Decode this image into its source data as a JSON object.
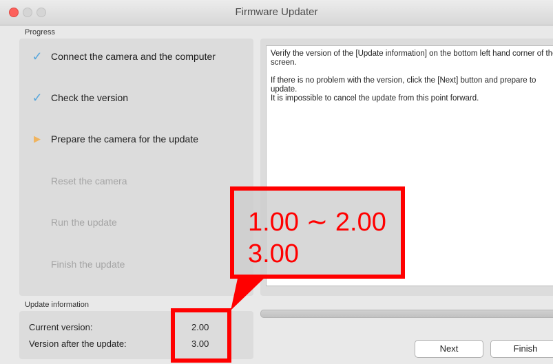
{
  "window": {
    "title": "Firmware Updater"
  },
  "progress": {
    "label": "Progress",
    "steps": [
      {
        "label": "Connect the camera and the computer",
        "state": "done",
        "icon": "checkmark-icon"
      },
      {
        "label": "Check the version",
        "state": "done",
        "icon": "checkmark-icon"
      },
      {
        "label": "Prepare the camera for the update",
        "state": "current",
        "icon": "play-arrow-icon"
      },
      {
        "label": "Reset the camera",
        "state": "pending"
      },
      {
        "label": "Run the update",
        "state": "pending"
      },
      {
        "label": "Finish the update",
        "state": "pending"
      }
    ]
  },
  "instructions": {
    "line1": "Verify the version of the [Update information] on the bottom left hand corner of the screen.",
    "line2": "If there is no problem with the version, click the [Next] button and prepare to update.",
    "line3": "It is impossible to cancel the update from this point forward."
  },
  "update_info": {
    "label": "Update information",
    "current_label": "Current version:",
    "current_value": "2.00",
    "after_label": "Version after the update:",
    "after_value": "3.00"
  },
  "buttons": {
    "next": "Next",
    "finish": "Finish"
  },
  "annotation": {
    "line1": "1.00 ∼ 2.00",
    "line2": "3.00",
    "color": "#ff0000"
  },
  "colors": {
    "check": "#58a7dc",
    "arrow": "#f0b45e",
    "close": "#fc605b"
  }
}
